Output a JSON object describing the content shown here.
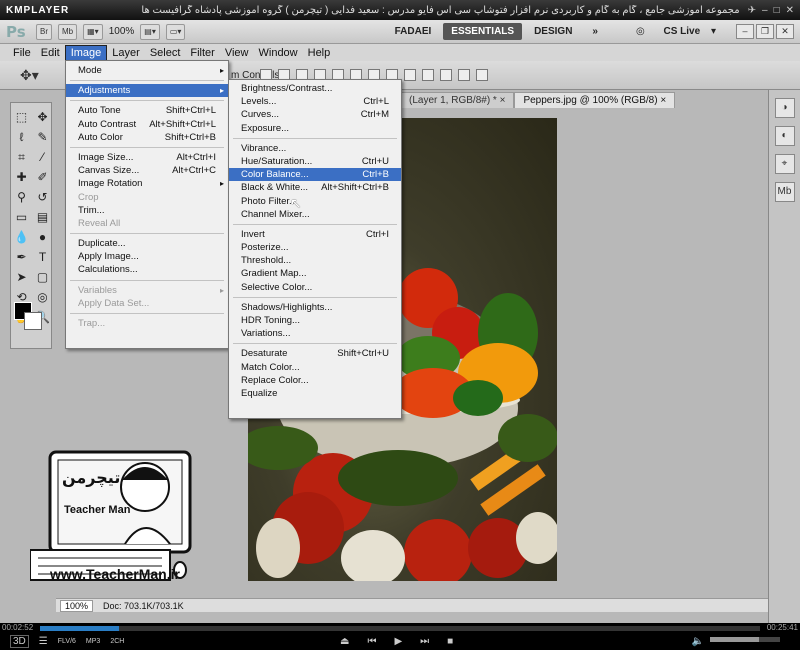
{
  "player": {
    "logo": "KMPLAYER",
    "title": "مجموعه آموزشی جامع ، گام به گام و کاربردی نرم افزار فتوشاپ سی اس فایو  مدرس : سعید فدایی ( تیچرمن ) گروه آموزشی پادشاه گرافیست ها",
    "time_elapsed": "00:02:52",
    "time_total": "00:25:41",
    "progress": 0.11,
    "volume": 0.7,
    "badges": [
      "FLV/6",
      "MP3",
      "2CH"
    ],
    "mode_label": "3D"
  },
  "photoshop": {
    "logo": "Ps",
    "app_buttons": [
      "Br",
      "Mb"
    ],
    "zoom": "100%",
    "workspaces": [
      "FADAEI",
      "ESSENTIALS",
      "DESIGN"
    ],
    "active_workspace": "ESSENTIALS",
    "more": "»",
    "cs_live": "CS Live"
  },
  "menubar": [
    "File",
    "Edit",
    "Image",
    "Layer",
    "Select",
    "Filter",
    "View",
    "Window",
    "Help"
  ],
  "open_menu": "Image",
  "options_bar": {
    "transform_label": "m Controls"
  },
  "tabs": [
    {
      "label": "(Layer 1, RGB/8#) *",
      "close": "×"
    },
    {
      "label": "Peppers.jpg @ 100% (RGB/8)",
      "close": "×"
    }
  ],
  "image_menu": [
    {
      "label": "Mode",
      "arrow": "▸"
    },
    {
      "sep": true
    },
    {
      "label": "Adjustments",
      "arrow": "▸",
      "hl": true
    },
    {
      "sep": true
    },
    {
      "label": "Auto Tone",
      "sc": "Shift+Ctrl+L"
    },
    {
      "label": "Auto Contrast",
      "sc": "Alt+Shift+Ctrl+L"
    },
    {
      "label": "Auto Color",
      "sc": "Shift+Ctrl+B"
    },
    {
      "sep": true
    },
    {
      "label": "Image Size...",
      "sc": "Alt+Ctrl+I"
    },
    {
      "label": "Canvas Size...",
      "sc": "Alt+Ctrl+C"
    },
    {
      "label": "Image Rotation",
      "arrow": "▸"
    },
    {
      "label": "Crop",
      "dis": true
    },
    {
      "label": "Trim..."
    },
    {
      "label": "Reveal All",
      "dis": true
    },
    {
      "sep": true
    },
    {
      "label": "Duplicate..."
    },
    {
      "label": "Apply Image..."
    },
    {
      "label": "Calculations..."
    },
    {
      "sep": true
    },
    {
      "label": "Variables",
      "arrow": "▸",
      "dis": true
    },
    {
      "label": "Apply Data Set...",
      "dis": true
    },
    {
      "sep": true
    },
    {
      "label": "Trap...",
      "dis": true
    }
  ],
  "adjustments_menu": [
    {
      "label": "Brightness/Contrast..."
    },
    {
      "label": "Levels...",
      "sc": "Ctrl+L"
    },
    {
      "label": "Curves...",
      "sc": "Ctrl+M"
    },
    {
      "label": "Exposure..."
    },
    {
      "sep": true
    },
    {
      "label": "Vibrance..."
    },
    {
      "label": "Hue/Saturation...",
      "sc": "Ctrl+U"
    },
    {
      "label": "Color Balance...",
      "sc": "Ctrl+B",
      "hl": true
    },
    {
      "label": "Black & White...",
      "sc": "Alt+Shift+Ctrl+B"
    },
    {
      "label": "Photo Filter..."
    },
    {
      "label": "Channel Mixer..."
    },
    {
      "sep": true
    },
    {
      "label": "Invert",
      "sc": "Ctrl+I"
    },
    {
      "label": "Posterize..."
    },
    {
      "label": "Threshold..."
    },
    {
      "label": "Gradient Map..."
    },
    {
      "label": "Selective Color..."
    },
    {
      "sep": true
    },
    {
      "label": "Shadows/Highlights..."
    },
    {
      "label": "HDR Toning..."
    },
    {
      "label": "Variations..."
    },
    {
      "sep": true
    },
    {
      "label": "Desaturate",
      "sc": "Shift+Ctrl+U"
    },
    {
      "label": "Match Color..."
    },
    {
      "label": "Replace Color..."
    },
    {
      "label": "Equalize"
    }
  ],
  "status": {
    "zoom": "100%",
    "doc": "Doc: 703.1K/703.1K"
  },
  "watermark": {
    "url": "www.TeacherMan.ir",
    "name": "Teacher Man",
    "farsi": "تیچرمن"
  },
  "colors": {
    "highlight": "#3b6fc4",
    "menu_bg": "#f0f0f0",
    "ps_bg": "#b8b8b8"
  }
}
